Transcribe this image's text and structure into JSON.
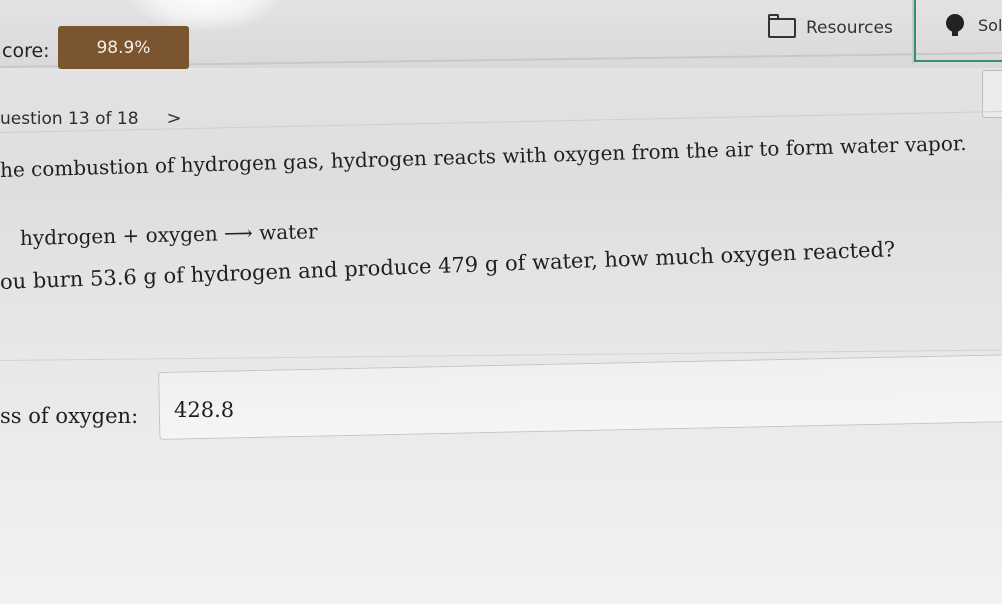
{
  "header": {
    "score_label": "core:",
    "score_value": "98.9%",
    "resources_label": "Resources",
    "solution_label": "Sol"
  },
  "nav": {
    "question_label": "uestion 13 of 18",
    "next_icon": "chevron-right-icon"
  },
  "question": {
    "line1": "he combustion of hydrogen gas, hydrogen reacts with oxygen from the air to form water vapor.",
    "equation": "hydrogen + oxygen ⟶ water",
    "line2": "ou burn 53.6 g of hydrogen and produce 479 g of water, how much oxygen reacted?"
  },
  "answer": {
    "label": "ss of oxygen:",
    "value": "428.8"
  },
  "colors": {
    "score_badge": "#7a5530",
    "solution_border": "#3a8a78"
  }
}
